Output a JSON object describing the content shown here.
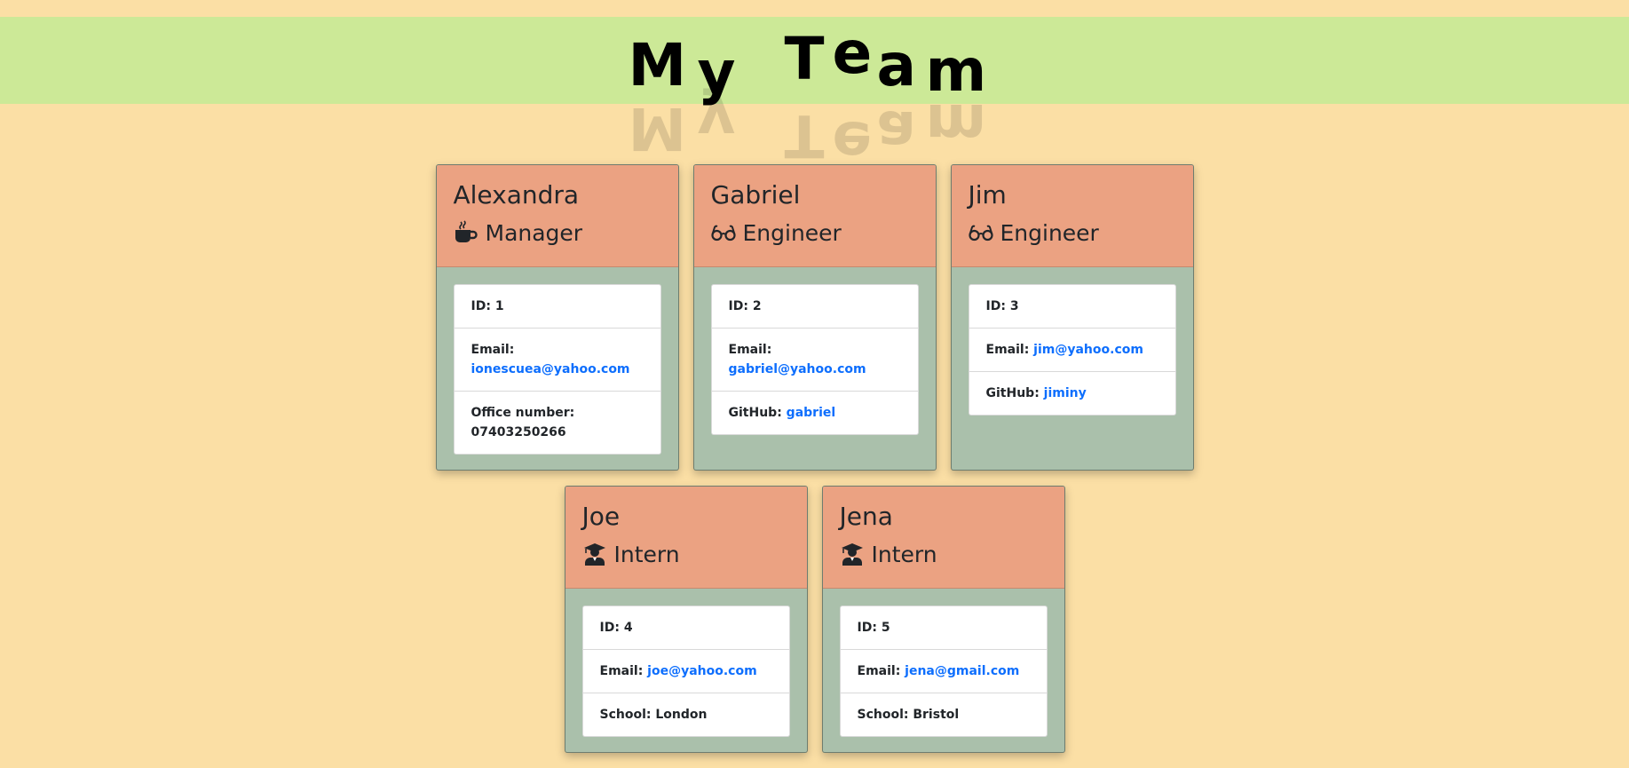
{
  "header": {
    "title": "My Team",
    "letters": [
      "M",
      "y",
      "T",
      "e",
      "a",
      "m"
    ]
  },
  "labels": {
    "id": "ID:",
    "email": "Email:",
    "office": "Office number:",
    "github": "GitHub:",
    "school": "School:"
  },
  "employees": [
    {
      "name": "Alexandra",
      "role": "Manager",
      "icon": "coffee-mug-icon",
      "id": "1",
      "email": "ionescuea@yahoo.com",
      "office": "07403250266"
    },
    {
      "name": "Gabriel",
      "role": "Engineer",
      "icon": "glasses-icon",
      "id": "2",
      "email": "gabriel@yahoo.com",
      "github": "gabriel"
    },
    {
      "name": "Jim",
      "role": "Engineer",
      "icon": "glasses-icon",
      "id": "3",
      "email": "jim@yahoo.com",
      "github": "jiminy"
    },
    {
      "name": "Joe",
      "role": "Intern",
      "icon": "graduate-icon",
      "id": "4",
      "email": "joe@yahoo.com",
      "school": "London"
    },
    {
      "name": "Jena",
      "role": "Intern",
      "icon": "graduate-icon",
      "id": "5",
      "email": "jena@gmail.com",
      "school": "Bristol"
    }
  ],
  "colors": {
    "page_bg": "#fbdfa5",
    "banner_bg": "#cce997",
    "card_header_bg": "#eba282",
    "card_body_bg": "#aac0ab",
    "link": "#0d6efd"
  }
}
